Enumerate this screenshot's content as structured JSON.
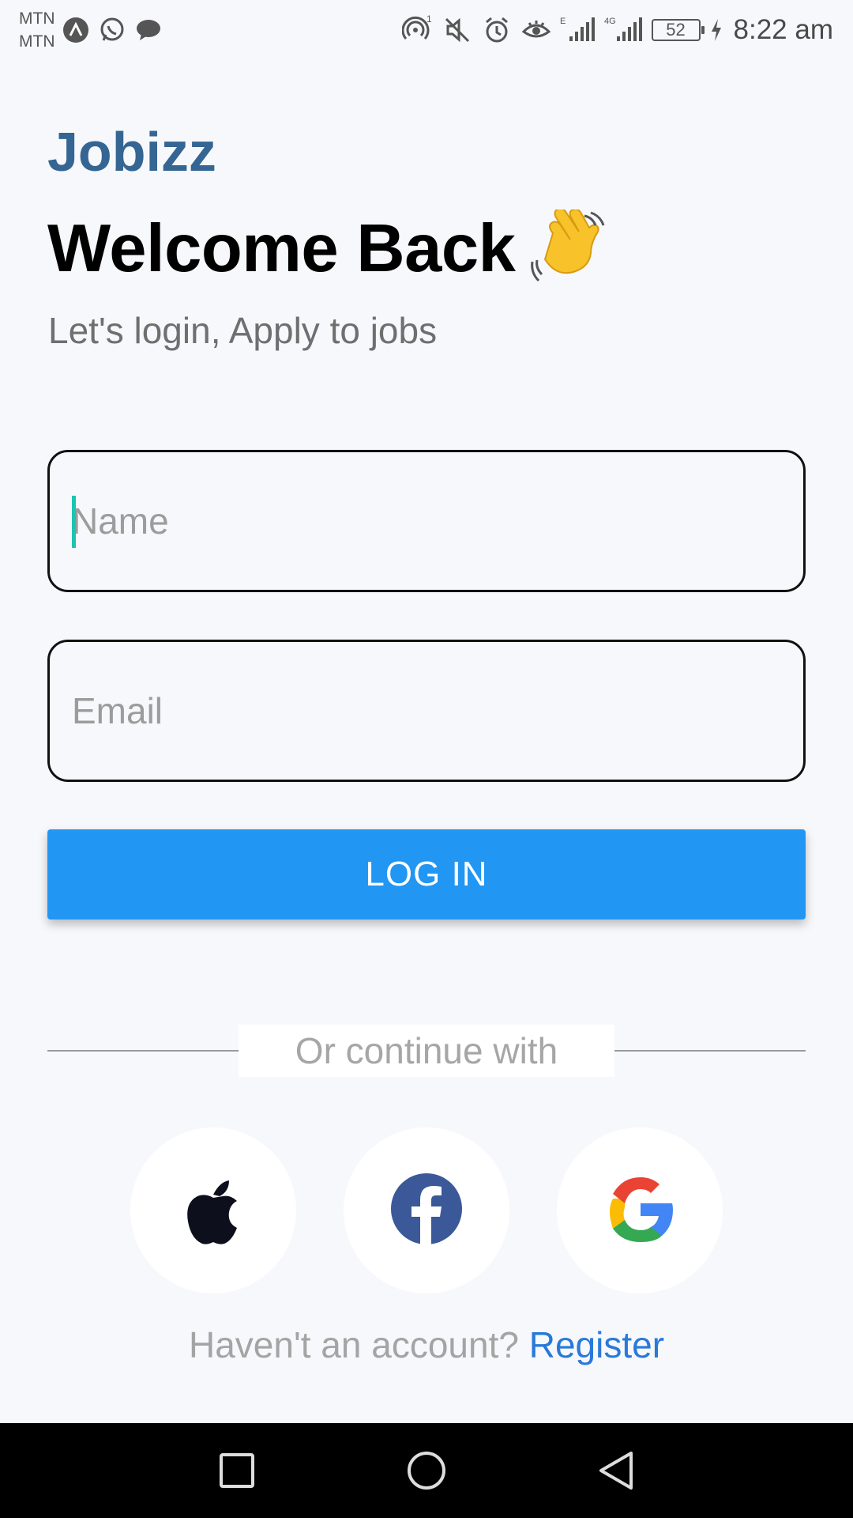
{
  "status_bar": {
    "carrier_1": "MTN",
    "carrier_2": "MTN",
    "icons_left": [
      "app-icon",
      "whatsapp-icon",
      "message-icon"
    ],
    "icons_right": [
      "hotspot-icon",
      "mute-icon",
      "alarm-icon",
      "eye-icon",
      "signal-icon",
      "signal-4g-icon",
      "battery-icon",
      "charging-icon"
    ],
    "network_badge": "E",
    "network_badge_2": "4G",
    "hotspot_count": "1",
    "battery": "52",
    "time": "8:22 am"
  },
  "header": {
    "app_name": "Jobizz",
    "title": "Welcome Back",
    "title_icon": "waving-hand-icon",
    "subtitle": "Let's login, Apply to jobs"
  },
  "form": {
    "name_placeholder": "Name",
    "name_value": "",
    "email_placeholder": "Email",
    "email_value": "",
    "login_label": "LOG IN"
  },
  "divider": {
    "text": "Or continue with"
  },
  "social": [
    {
      "name": "apple-icon"
    },
    {
      "name": "facebook-icon"
    },
    {
      "name": "google-icon"
    }
  ],
  "footer": {
    "prompt": "Haven't an account?",
    "register_label": "Register"
  },
  "nav": {
    "buttons": [
      "recents-icon",
      "home-icon",
      "back-icon"
    ]
  },
  "colors": {
    "brand": "#356592",
    "primary_button": "#2196f3",
    "link": "#2979d9",
    "caret": "#1ec4b0",
    "background": "#f7f8fb"
  }
}
